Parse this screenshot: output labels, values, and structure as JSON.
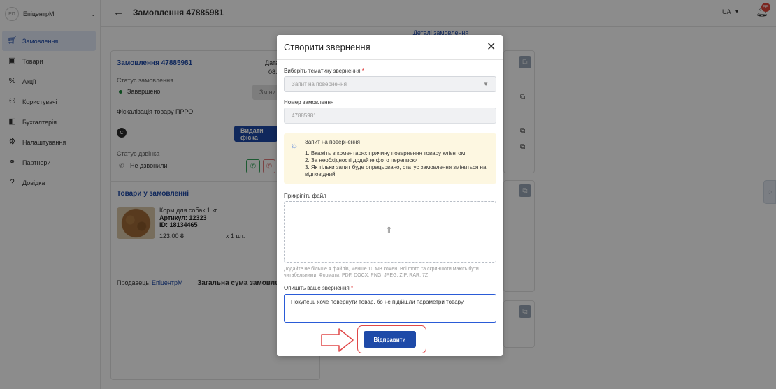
{
  "colors": {
    "accent": "#1e4aa8",
    "status_green": "#1e8a3c",
    "notification_red": "#e0463a",
    "annotation_red": "#e04848",
    "info_bg": "#fdf7e1"
  },
  "sidebar": {
    "avatar_text": "ЕП",
    "brand_name": "ЕпіцентрМ",
    "items": [
      {
        "label": "Замовлення",
        "icon": "cart-icon"
      },
      {
        "label": "Товари",
        "icon": "box-icon"
      },
      {
        "label": "Акції",
        "icon": "percent-tag-icon"
      },
      {
        "label": "Користувачі",
        "icon": "users-icon"
      },
      {
        "label": "Бухгалтерія",
        "icon": "wallet-icon"
      },
      {
        "label": "Налаштування",
        "icon": "gear-icon"
      },
      {
        "label": "Партнери",
        "icon": "handshake-icon"
      },
      {
        "label": "Довідка",
        "icon": "help-icon"
      }
    ]
  },
  "header": {
    "title": "Замовлення 47885981",
    "language": "UA",
    "notifications_count": "99"
  },
  "tabs": {
    "details": "Деталі замовлення"
  },
  "order": {
    "link": "Замовлення 47885981",
    "date_label": "Дата",
    "date_value": "08.",
    "status_label": "Статус замовлення",
    "status_value": "Завершено",
    "change_button": "Змінит",
    "fiscal_label": "Фіскалізація товару ПРРО",
    "fiscal_badge": "C",
    "fiscal_button": "Видати фіска",
    "call_status_label": "Статус дзвінка",
    "call_status_value": "Не дзвонили",
    "goods_title": "Товари у замовленні",
    "product_name": "Корм для собак 1 кг",
    "product_article": "Артикул: 12323",
    "product_id": "ID: 18134465",
    "product_price": "123.00 ₴",
    "product_qty": "х 1 шт.",
    "seller_label": "Продавець:",
    "seller_value": "ЕпіцентрМ",
    "total_label": "Загальна сума замовлен"
  },
  "modal": {
    "title": "Створити звернення",
    "topic_label": "Виберіть тематику звернення",
    "topic_value": "Запит на повернення",
    "order_number_label": "Номер замовлення",
    "order_number_value": "47885981",
    "info_title": "Запит на повернення",
    "info_lines": [
      "1. Вкажіть в коментарях причину повернення товару клієнтом",
      "2. За необхідності додайте фото переписки",
      "3. Як тільки запит буде опрацьовано, статус замовлення зміниться на відповідний"
    ],
    "attach_label": "Прикріпіть файл",
    "attach_hint": "Додайте не більше 4 файлів, менше 10 МВ кожен. Всі фото та скриншоти мають бути читабельними. Формати: PDF, DOCX, PNG, JPEG, ZIP, RAR, 7Z",
    "describe_label": "Опишіть ваше звернення",
    "describe_value": "Покупець хоче повернути товар, бо не підійшли параметри товару",
    "submit_button": "Відправити"
  }
}
